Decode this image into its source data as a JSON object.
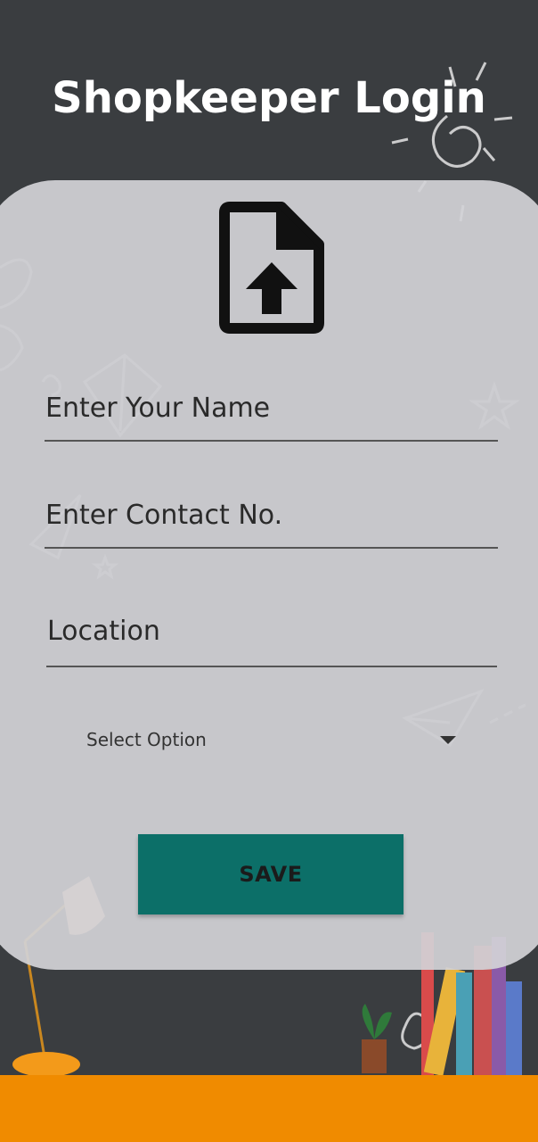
{
  "header": {
    "title": "Shopkeeper Login"
  },
  "form": {
    "upload_icon": "file-upload-icon",
    "name_placeholder": "Enter Your Name",
    "contact_placeholder": "Enter Contact No.",
    "location_placeholder": "Location",
    "select": {
      "selected": "Select Option",
      "icon": "dropdown-arrow-icon"
    },
    "save_label": "SAVE"
  },
  "colors": {
    "background": "#3a3d40",
    "card": "#d2d2d6",
    "accent": "#0c6f68",
    "floor": "#f08b00"
  }
}
